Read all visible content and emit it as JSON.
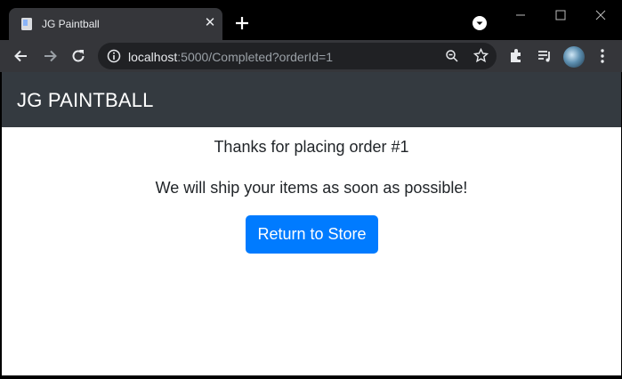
{
  "browser": {
    "tab": {
      "title": "JG Paintball"
    },
    "address_bar": {
      "host": "localhost",
      "path": ":5000/Completed?orderId=1"
    }
  },
  "page": {
    "brand": "JG PAINTBALL",
    "message_line1": "Thanks for placing order #1",
    "message_line2": "We will ship your items as soon as possible!",
    "return_button_label": "Return to Store"
  },
  "colors": {
    "navbar": "#343a40",
    "button": "#007bff",
    "browser_chrome": "#35363a"
  }
}
